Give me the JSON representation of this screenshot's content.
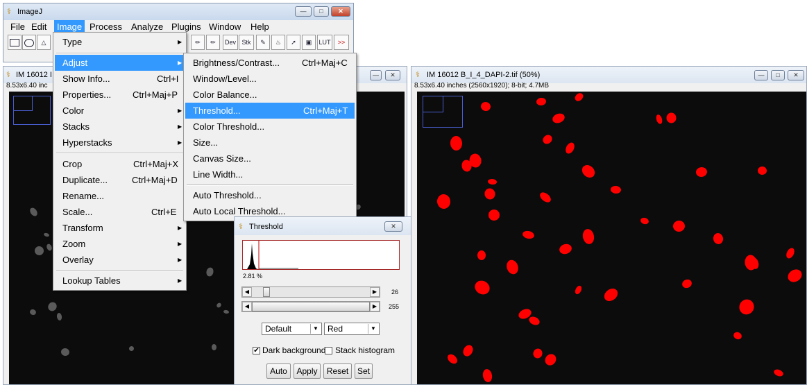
{
  "main_window": {
    "title": "ImageJ",
    "menus": [
      "File",
      "Edit",
      "Image",
      "Process",
      "Analyze",
      "Plugins",
      "Window",
      "Help"
    ],
    "active_menu": "Image",
    "tools": [
      "rectangle",
      "oval",
      "polygon",
      "freehand",
      "line",
      "angle",
      "point",
      "wand",
      "text",
      "magnifier",
      "hand",
      "dropper"
    ],
    "tool_labels": {
      "dev": "Dev",
      "stk": "Stk",
      "lut": "LUT",
      "more": ">>"
    }
  },
  "image_menu": [
    {
      "label": "Type",
      "shortcut": "",
      "submenu": true
    },
    {
      "label": "Adjust",
      "shortcut": "",
      "submenu": true,
      "highlighted": true
    },
    {
      "label": "Show Info...",
      "shortcut": "Ctrl+I",
      "submenu": false
    },
    {
      "label": "Properties...",
      "shortcut": "Ctrl+Maj+P",
      "submenu": false
    },
    {
      "label": "Color",
      "shortcut": "",
      "submenu": true
    },
    {
      "label": "Stacks",
      "shortcut": "",
      "submenu": true
    },
    {
      "label": "Hyperstacks",
      "shortcut": "",
      "submenu": true
    },
    {
      "label": "Crop",
      "shortcut": "Ctrl+Maj+X",
      "submenu": false
    },
    {
      "label": "Duplicate...",
      "shortcut": "Ctrl+Maj+D",
      "submenu": false
    },
    {
      "label": "Rename...",
      "shortcut": "",
      "submenu": false
    },
    {
      "label": "Scale...",
      "shortcut": "Ctrl+E",
      "submenu": false
    },
    {
      "label": "Transform",
      "shortcut": "",
      "submenu": true
    },
    {
      "label": "Zoom",
      "shortcut": "",
      "submenu": true
    },
    {
      "label": "Overlay",
      "shortcut": "",
      "submenu": true
    },
    {
      "label": "Lookup Tables",
      "shortcut": "",
      "submenu": true
    }
  ],
  "adjust_menu": [
    {
      "label": "Brightness/Contrast...",
      "shortcut": "Ctrl+Maj+C"
    },
    {
      "label": "Window/Level...",
      "shortcut": ""
    },
    {
      "label": "Color Balance...",
      "shortcut": ""
    },
    {
      "label": "Threshold...",
      "shortcut": "Ctrl+Maj+T",
      "highlighted": true
    },
    {
      "label": "Color Threshold...",
      "shortcut": ""
    },
    {
      "label": "Size...",
      "shortcut": ""
    },
    {
      "label": "Canvas Size...",
      "shortcut": ""
    },
    {
      "label": "Line Width...",
      "shortcut": ""
    },
    {
      "label": "Auto Threshold...",
      "shortcut": ""
    },
    {
      "label": "Auto Local Threshold...",
      "shortcut": ""
    }
  ],
  "left_image_window": {
    "title": "IM 16012 I",
    "info": "8.53x6.40 inc"
  },
  "right_image_window": {
    "title": "IM 16012 B_I_4_DAPI-2.tif (50%)",
    "info": "8.53x6.40 inches (2560x1920); 8-bit; 4.7MB"
  },
  "threshold_dialog": {
    "title": "Threshold",
    "percent": "2.81 %",
    "lower_value": "26",
    "upper_value": "255",
    "lower_fraction": 0.102,
    "upper_fraction": 1.0,
    "method": "Default",
    "display": "Red",
    "dark_background_label": "Dark background",
    "dark_background_checked": true,
    "stack_histogram_label": "Stack histogram",
    "stack_histogram_checked": false,
    "buttons": [
      "Auto",
      "Apply",
      "Reset",
      "Set"
    ]
  },
  "colors": {
    "highlight": "#3399ff",
    "threshold_red": "#ff0000",
    "window_title": "#dbe5f1"
  }
}
